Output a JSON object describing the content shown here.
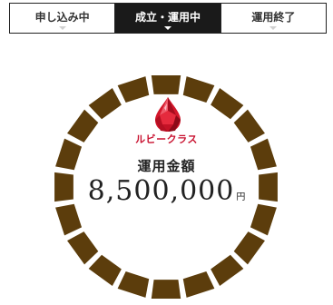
{
  "tabs": [
    {
      "label": "申し込み中",
      "active": false
    },
    {
      "label": "成立・運用中",
      "active": true
    },
    {
      "label": "運用終了",
      "active": false
    }
  ],
  "card": {
    "class_name": "ルビークラス",
    "amount_label": "運用金額",
    "amount_value": "8,500,000",
    "amount_unit": "円",
    "icon": "ruby-gem-icon"
  },
  "ring": {
    "segments": 20,
    "filled_segments": 20,
    "color": "#5c3d0c"
  },
  "colors": {
    "accent": "#c8102e",
    "ring": "#5c3d0c",
    "tab_active_bg": "#1a1a1a"
  }
}
